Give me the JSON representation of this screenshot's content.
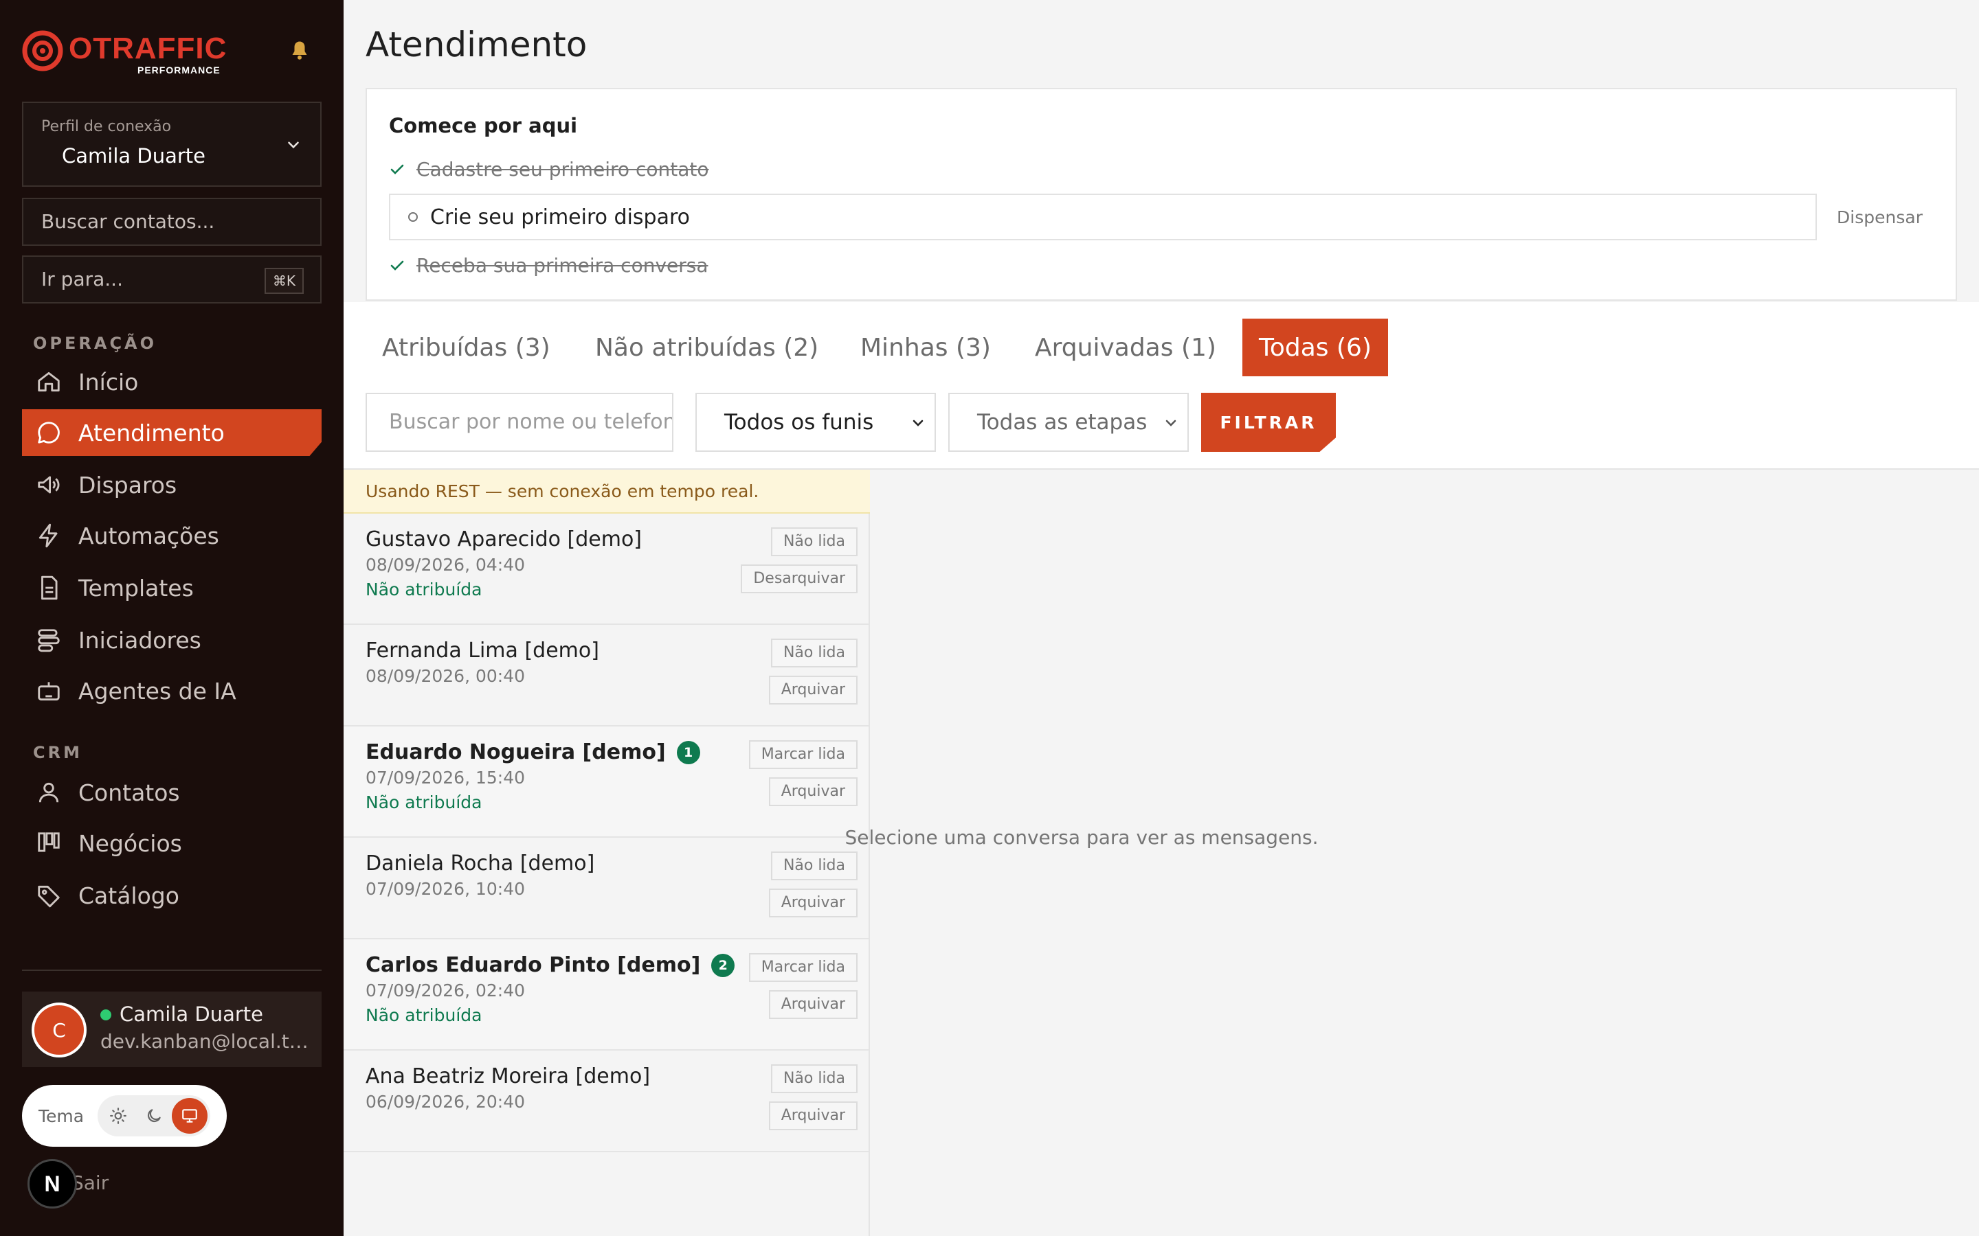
{
  "brand": {
    "name": "OTRAFFIC",
    "tagline": "PERFORMANCE",
    "accent": "#d2451f"
  },
  "sidebar": {
    "profile": {
      "caption": "Perfil de conexão",
      "name": "Camila Duarte"
    },
    "search_placeholder": "Buscar contatos...",
    "goto_placeholder": "Ir para...",
    "goto_shortcut": "⌘K",
    "sections": [
      {
        "title": "OPERAÇÃO",
        "items": [
          {
            "label": "Início",
            "icon": "home-icon"
          },
          {
            "label": "Atendimento",
            "icon": "chat-icon",
            "active": true
          },
          {
            "label": "Disparos",
            "icon": "megaphone-icon"
          },
          {
            "label": "Automações",
            "icon": "bolt-icon"
          },
          {
            "label": "Templates",
            "icon": "document-icon"
          },
          {
            "label": "Iniciadores",
            "icon": "layers-icon"
          },
          {
            "label": "Agentes de IA",
            "icon": "bot-icon"
          }
        ]
      },
      {
        "title": "CRM",
        "items": [
          {
            "label": "Contatos",
            "icon": "user-icon"
          },
          {
            "label": "Negócios",
            "icon": "kanban-icon"
          },
          {
            "label": "Catálogo",
            "icon": "tag-icon"
          }
        ]
      }
    ],
    "user": {
      "initial": "C",
      "name": "Camila Duarte",
      "email": "dev.kanban@local.test",
      "status_color": "#2ecc71"
    },
    "theme": {
      "label": "Tema",
      "options": [
        "sun-icon",
        "moon-icon",
        "monitor-icon"
      ],
      "selected": "monitor-icon"
    },
    "logout_label": "Sair",
    "next_badge": "N"
  },
  "main": {
    "title": "Atendimento",
    "onboarding": {
      "heading": "Comece por aqui",
      "steps": [
        {
          "label": "Cadastre seu primeiro contato",
          "done": true
        },
        {
          "label": "Crie seu primeiro disparo",
          "done": false
        },
        {
          "label": "Receba sua primeira conversa",
          "done": true
        }
      ],
      "dismiss_label": "Dispensar"
    },
    "tabs": [
      {
        "label": "Atribuídas (3)"
      },
      {
        "label": "Não atribuídas (2)"
      },
      {
        "label": "Minhas (3)"
      },
      {
        "label": "Arquivadas (1)"
      },
      {
        "label": "Todas (6)",
        "active": true
      }
    ],
    "filters": {
      "search_placeholder": "Buscar por nome ou telefone",
      "funnel_selected": "Todos os funis",
      "stage_selected": "Todas as etapas",
      "button": "FILTRAR"
    },
    "notice": "Usando REST — sem conexão em tempo real.",
    "conversations": [
      {
        "name": "Gustavo Aparecido [demo]",
        "date": "08/09/2026, 04:40",
        "status": "Não atribuída",
        "unread_count": null,
        "actions": [
          "Não lida",
          "Desarquivar"
        ]
      },
      {
        "name": "Fernanda Lima [demo]",
        "date": "08/09/2026, 00:40",
        "status": "",
        "unread_count": null,
        "actions": [
          "Não lida",
          "Arquivar"
        ]
      },
      {
        "name": "Eduardo Nogueira [demo]",
        "date": "07/09/2026, 15:40",
        "status": "Não atribuída",
        "unread_count": "1",
        "actions": [
          "Marcar lida",
          "Arquivar"
        ]
      },
      {
        "name": "Daniela Rocha [demo]",
        "date": "07/09/2026, 10:40",
        "status": "",
        "unread_count": null,
        "actions": [
          "Não lida",
          "Arquivar"
        ]
      },
      {
        "name": "Carlos Eduardo Pinto [demo]",
        "date": "07/09/2026, 02:40",
        "status": "Não atribuída",
        "unread_count": "2",
        "actions": [
          "Marcar lida",
          "Arquivar"
        ]
      },
      {
        "name": "Ana Beatriz Moreira [demo]",
        "date": "06/09/2026, 20:40",
        "status": "",
        "unread_count": null,
        "actions": [
          "Não lida",
          "Arquivar"
        ]
      }
    ],
    "empty_state": "Selecione uma conversa para ver as mensagens."
  }
}
